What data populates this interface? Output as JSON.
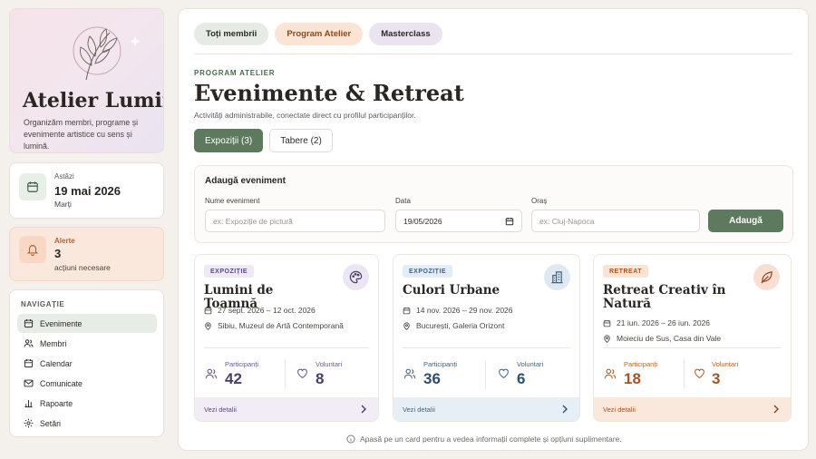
{
  "brand": {
    "name": "Atelier Luminis",
    "tagline": "Organizăm membri, programe și evenimente artistice cu sens și lumină."
  },
  "today": {
    "label": "Astăzi",
    "date": "19 mai 2026",
    "weekday": "Marți"
  },
  "alerts": {
    "label": "Alerte",
    "count": "3",
    "text": "acțiuni necesare"
  },
  "nav": {
    "header": "NAVIGAȚIE",
    "items": [
      {
        "label": "Evenimente",
        "icon": "calendar-icon",
        "active": true
      },
      {
        "label": "Membri",
        "icon": "users-icon"
      },
      {
        "label": "Calendar",
        "icon": "calendar-icon"
      },
      {
        "label": "Comunicate",
        "icon": "mail-icon"
      },
      {
        "label": "Rapoarte",
        "icon": "bar-chart-icon"
      },
      {
        "label": "Setări",
        "icon": "gear-icon"
      }
    ]
  },
  "tabs": [
    "Toți membrii",
    "Program Atelier",
    "Masterclass"
  ],
  "header": {
    "eyebrow": "PROGRAM ATELIER",
    "title": "Evenimente & Retreat",
    "description": "Activități administrabile, conectate direct cu profilul participanților."
  },
  "segments": [
    "Expoziții (3)",
    "Tabere (2)"
  ],
  "form": {
    "title": "Adaugă eveniment",
    "name_label": "Nume eveniment",
    "name_placeholder": "ex: Expoziție de pictură",
    "date_label": "Data",
    "date_value": "19/05/2026",
    "city_label": "Oraș",
    "city_placeholder": "ex: Cluj-Napoca",
    "submit": "Adaugă"
  },
  "events": [
    {
      "badge": "EXPOZIȚIE",
      "title": "Lumini de Toamnă",
      "dates": "27 sept. 2026 – 12 oct. 2026",
      "place": "Sibiu, Muzeul de Artă Contemporană",
      "participants_label": "Participanți",
      "participants": "42",
      "volunteers_label": "Voluntari",
      "volunteers": "8",
      "details": "Vezi detalii",
      "icon": "palette-icon",
      "accent": "#6a5a8c"
    },
    {
      "badge": "EXPOZIȚIE",
      "title": "Culori Urbane",
      "dates": "14 nov. 2026 – 29 nov. 2026",
      "place": "București, Galeria Orizont",
      "participants_label": "Participanți",
      "participants": "36",
      "volunteers_label": "Voluntari",
      "volunteers": "6",
      "details": "Vezi detalii",
      "icon": "building-icon",
      "accent": "#4a6e8c"
    },
    {
      "badge": "RETREAT",
      "title": "Retreat Creativ în Natură",
      "dates": "21 iun. 2026 – 26 iun. 2026",
      "place": "Moieciu de Sus, Casa din Vale",
      "participants_label": "Participanți",
      "participants": "18",
      "volunteers_label": "Voluntari",
      "volunteers": "3",
      "details": "Vezi detalii",
      "icon": "leaf-icon",
      "accent": "#b5632c"
    }
  ],
  "hint": "Apasă pe un card pentru a vedea informații complete și opțiuni suplimentare."
}
